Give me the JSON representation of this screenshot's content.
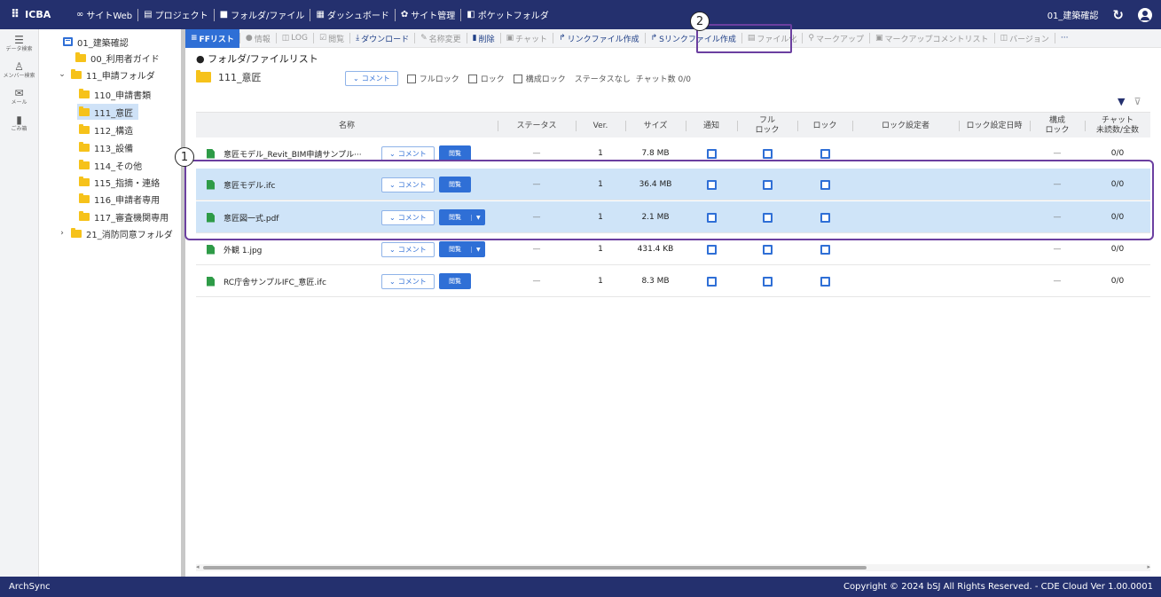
{
  "topbar": {
    "brand": "ICBA",
    "nav": [
      "サイトWeb",
      "プロジェクト",
      "フォルダ/ファイル",
      "ダッシュボード",
      "サイト管理",
      "ポケットフォルダ"
    ],
    "project_name": "01_建築確認"
  },
  "rail": [
    {
      "icon": "data-search-icon",
      "label": "データ検索"
    },
    {
      "icon": "member-search-icon",
      "label": "メンバー検索"
    },
    {
      "icon": "mail-icon",
      "label": "メール"
    },
    {
      "icon": "trash-icon",
      "label": "ごみ箱"
    }
  ],
  "tree": {
    "root": "01_建築確認",
    "items": [
      "00_利用者ガイド",
      "11_申請フォルダ",
      "110_申請書類",
      "111_意匠",
      "112_構造",
      "113_設備",
      "114_その他",
      "115_指摘・連絡",
      "116_申請者専用",
      "117_審査機関専用",
      "21_消防同意フォルダ"
    ],
    "selected": "111_意匠"
  },
  "toolbar": [
    "FFリスト",
    "情報",
    "LOG",
    "閲覧",
    "ダウンロード",
    "名称変更",
    "削除",
    "チャット",
    "リンクファイル作成",
    "Sリンクファイル作成",
    "ファイル化",
    "マークアップ",
    "マークアップコメントリスト",
    "バージョン",
    "···"
  ],
  "main": {
    "list_title": "● フォルダ/ファイルリスト",
    "folder_name": "111_意匠",
    "comment_label": "コメント",
    "filters": [
      "フルロック",
      "ロック",
      "構成ロック"
    ],
    "status_text": "ステータスなし",
    "chat_count": "チャット数 0/0"
  },
  "table": {
    "headers": {
      "name": "名称",
      "status": "ステータス",
      "ver": "Ver.",
      "size": "サイズ",
      "notify": "通知",
      "full_lock": "フル\nロック",
      "lock": "ロック",
      "lock_user": "ロック設定者",
      "lock_date": "ロック設定日時",
      "config_lock": "構成\nロック",
      "chat": "チャット\n未読数/全数"
    },
    "comment_label": "コメント",
    "view_label": "閲覧",
    "rows": [
      {
        "name": "意匠モデル_Revit_BIM申請サンプル···",
        "status": "—",
        "ver": "1",
        "size": "7.8 MB",
        "config": "—",
        "chat": "0/0",
        "dropdown": false
      },
      {
        "name": "意匠モデル.ifc",
        "status": "—",
        "ver": "1",
        "size": "36.4 MB",
        "config": "—",
        "chat": "0/0",
        "dropdown": false
      },
      {
        "name": "意匠図一式.pdf",
        "status": "—",
        "ver": "1",
        "size": "2.1 MB",
        "config": "—",
        "chat": "0/0",
        "dropdown": true
      },
      {
        "name": "外観 1.jpg",
        "status": "—",
        "ver": "1",
        "size": "431.4 KB",
        "config": "—",
        "chat": "0/0",
        "dropdown": true
      },
      {
        "name": "RC庁舎サンプルIFC_意匠.ifc",
        "status": "—",
        "ver": "1",
        "size": "8.3 MB",
        "config": "—",
        "chat": "0/0",
        "dropdown": false
      }
    ]
  },
  "annotations": [
    "1",
    "2"
  ],
  "footer": {
    "left": "ArchSync",
    "right": "Copyright © 2024 bSJ All Rights Reserved. - CDE Cloud Ver 1.00.0001"
  },
  "colors": {
    "header": "#24306e",
    "accent": "#2f6fd6",
    "highlight": "#cfe4f8",
    "annotation": "#6b3fa0",
    "folder": "#f6c21a",
    "file": "#2e9b47"
  }
}
